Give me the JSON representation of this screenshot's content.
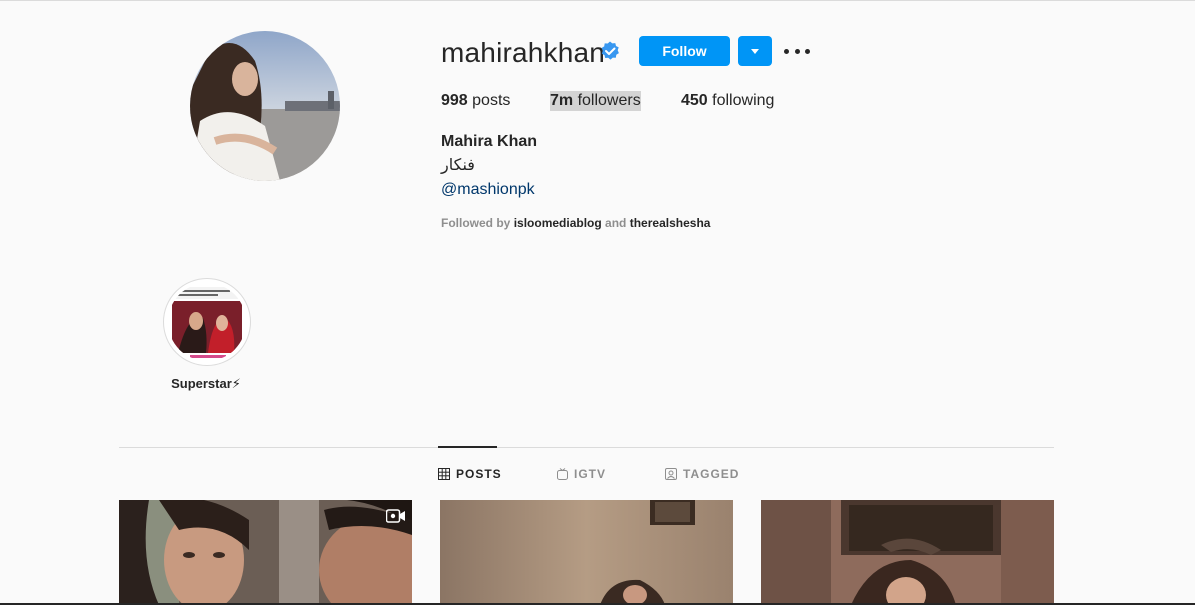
{
  "profile": {
    "username": "mahirahkhan",
    "follow_label": "Follow",
    "posts_count": "998",
    "posts_label": "posts",
    "followers_count": "7m",
    "followers_label": "followers",
    "following_count": "450",
    "following_label": "following",
    "full_name": "Mahira Khan",
    "bio": "فنکار",
    "bio_link": "@mashionpk",
    "followed_by_prefix": "Followed by",
    "followed_by_1": "isloomediablog",
    "followed_by_and": "and",
    "followed_by_2": "therealshesha"
  },
  "highlights": [
    {
      "label": "Superstar⚡"
    }
  ],
  "tabs": {
    "posts": "POSTS",
    "igtv": "IGTV",
    "tagged": "TAGGED"
  },
  "colors": {
    "accent": "#0095f6",
    "background": "#fafafa",
    "link": "#00376b",
    "muted": "#8e8e8e"
  }
}
